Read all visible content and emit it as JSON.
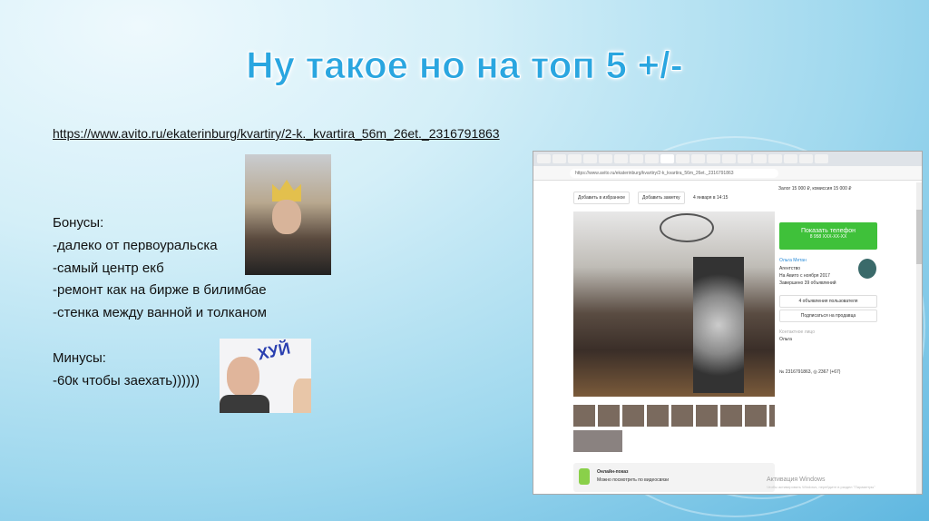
{
  "slide": {
    "title": "Ну такое но на топ 5 +/-",
    "url": "https://www.avito.ru/ekaterinburg/kvartiry/2-k._kvartira_56m_26et._2316791863",
    "bonuses_header": "Бонусы:",
    "bonuses": [
      "-далеко от первоуральска",
      "-самый центр екб",
      "-ремонт как на бирже в билимбае",
      "-стенка между ванной и толканом"
    ],
    "minuses_header": "Минусы:",
    "minuses": [
      "-60к чтобы заехать))))))"
    ],
    "photo2_scribble": "ХУЙ"
  },
  "browser": {
    "address": "https://www.avito.ru/ekaterinburg/kvartiry/2-k_kvartira_56m_26et._2316791863",
    "add_favorite": "Добавить в избранное",
    "add_note": "Добавить заметку",
    "date": "4 января в 14:15",
    "deposit": "Залог 15 000 ₽, комиссия 15 000 ₽",
    "show_phone": "Показать телефон",
    "phone_mask": "8 958 XXX-XX-XX",
    "seller_name": "Ольга Метан",
    "seller_type": "Агентство",
    "seller_since": "На Авито с ноября 2017",
    "seller_completed": "Завершено 39 объявлений",
    "user_ads": "4 объявления пользователя",
    "subscribe": "Подписаться на продавца",
    "contact_label": "Контактное лицо",
    "contact_name": "Ольга",
    "listing_id": "№ 2316791863,",
    "views": "2367 (+67)",
    "online_title": "Онлайн-показ",
    "online_sub": "Можно посмотреть по видеосвязи",
    "watermark1": "Активация Windows",
    "watermark2": "Чтобы активировать Windows, перейдите в раздел \"Параметры\""
  }
}
